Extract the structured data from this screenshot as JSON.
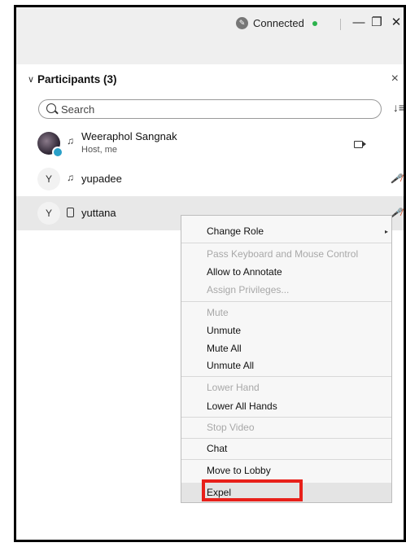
{
  "titlebar": {
    "status": "Connected",
    "status_color": "#2bb24c",
    "minimize_icon": "minimize-icon",
    "restore_icon": "restore-icon",
    "close_icon": "close-icon"
  },
  "panel": {
    "title": "Participants (3)",
    "search_placeholder": "Search"
  },
  "participants": [
    {
      "name": "Weeraphol Sangnak",
      "role": "Host, me",
      "avatar": "photo"
    },
    {
      "name": "yupadee",
      "avatar_letter": "Y"
    },
    {
      "name": "yuttana",
      "avatar_letter": "Y"
    }
  ],
  "context_menu": {
    "change_role": "Change Role",
    "pass_keyboard": "Pass Keyboard and Mouse Control",
    "allow_annotate": "Allow to Annotate",
    "assign_privileges": "Assign Privileges...",
    "mute": "Mute",
    "unmute": "Unmute",
    "mute_all": "Mute All",
    "unmute_all": "Unmute All",
    "lower_hand": "Lower Hand",
    "lower_all_hands": "Lower All Hands",
    "stop_video": "Stop Video",
    "chat": "Chat",
    "move_to_lobby": "Move to Lobby",
    "expel": "Expel"
  },
  "highlight_color": "#e8201a"
}
